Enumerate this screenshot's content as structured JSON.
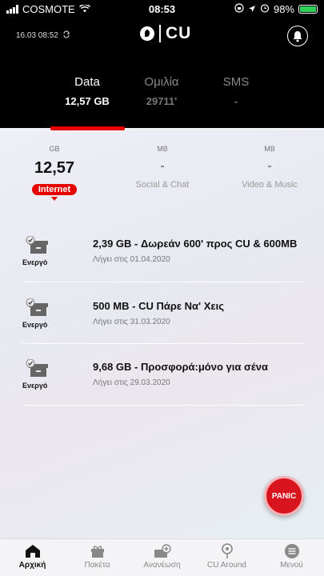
{
  "status_bar": {
    "carrier": "COSMOTE",
    "time": "08:53",
    "battery": "98%",
    "battery_level": 0.98
  },
  "header": {
    "timestamp": "16.03 08:52",
    "logo_text": "CU"
  },
  "tabs": [
    {
      "label": "Data",
      "value": "12,57 GB"
    },
    {
      "label": "Ομιλία",
      "value": "29711'"
    },
    {
      "label": "SMS",
      "value": "-"
    }
  ],
  "categories": [
    {
      "unit": "GB",
      "value": "12,57",
      "name": "Internet"
    },
    {
      "unit": "MB",
      "value": "-",
      "name": "Social & Chat"
    },
    {
      "unit": "MB",
      "value": "-",
      "name": "Video & Music"
    }
  ],
  "offers": [
    {
      "status": "Ενεργό",
      "title": "2,39 GB - Δωρεάν 600' προς CU & 600MB",
      "expiry": "Λήγει στις 01.04.2020"
    },
    {
      "status": "Ενεργό",
      "title": "500 MB - CU Πάρε Να' Χεις",
      "expiry": "Λήγει στις 31.03.2020"
    },
    {
      "status": "Ενεργό",
      "title": "9,68 GB - Προσφορά:μόνο για σένα",
      "expiry": "Λήγει στις 29.03.2020"
    }
  ],
  "panic_label": "PANIC",
  "nav": [
    {
      "label": "Αρχική",
      "icon": "home-icon"
    },
    {
      "label": "Πακέτα",
      "icon": "gift-icon"
    },
    {
      "label": "Ανανέωση",
      "icon": "renew-icon"
    },
    {
      "label": "CU Around",
      "icon": "location-icon"
    },
    {
      "label": "Μενού",
      "icon": "menu-icon"
    }
  ],
  "colors": {
    "accent": "#e60000",
    "header_bg": "#000000"
  }
}
